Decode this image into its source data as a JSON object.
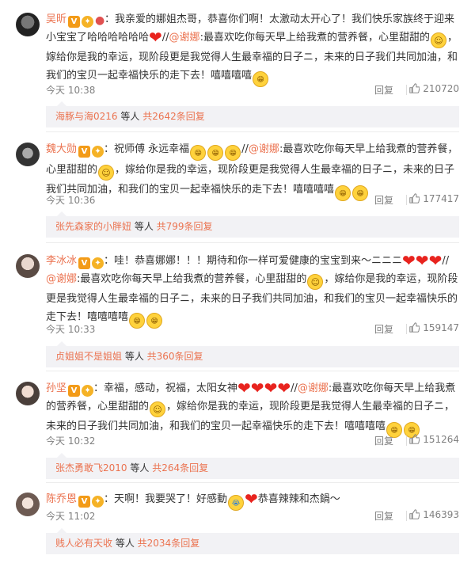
{
  "comments": [
    {
      "username": "吴昕",
      "text_1": "：我亲爱的娜姐杰哥，恭喜你们啊！太激动太开心了！我们快乐家族终于迎来小宝宝了哈哈哈哈哈哈",
      "forward": "//",
      "mention": "@谢娜",
      "text_2": ":最喜欢吃你每天早上给我煮的营养餐，心里甜甜的",
      "text_3": "，嫁给你是我的幸运，现阶段更是我觉得人生最幸福的日子ニ，未来的日子我们共同加油，和我们的宝贝一起幸福快乐的走下去！嘻嘻嘻嘻",
      "time": "今天 10:38",
      "reply_label": "回复",
      "likes": "210720",
      "sub_user": "海豚与海0216",
      "sub_mid": " 等人 ",
      "sub_total": "共2642条回复"
    },
    {
      "username": "魏大勋",
      "text_1": "：祝师傅 永远幸福",
      "forward": "//",
      "mention": "@谢娜",
      "text_2": ":最喜欢吃你每天早上给我煮的营养餐，心里甜甜的",
      "text_3": "，嫁给你是我的幸运，现阶段更是我觉得人生最幸福的日子ニ，未来的日子我们共同加油，和我们的宝贝一起幸福快乐的走下去！嘻嘻嘻嘻",
      "time": "今天 10:36",
      "reply_label": "回复",
      "likes": "177417",
      "sub_user": "张先森家的小胖妞",
      "sub_mid": " 等人 ",
      "sub_total": "共799条回复"
    },
    {
      "username": "李冰冰",
      "text_1": "：哇！恭喜娜娜！！！期待和你一样可爱健康的宝宝到来～ニニニ",
      "forward": "//",
      "mention": "@谢娜",
      "text_2": ":最喜欢吃你每天早上给我煮的营养餐，心里甜甜的",
      "text_3": "，嫁给你是我的幸运，现阶段更是我觉得人生最幸福的日子ニ，未来的日子我们共同加油，和我们的宝贝一起幸福快乐的走下去！嘻嘻嘻嘻",
      "time": "今天 10:33",
      "reply_label": "回复",
      "likes": "159147",
      "sub_user": "贞姐姐不是姐姐",
      "sub_mid": " 等人 ",
      "sub_total": "共360条回复"
    },
    {
      "username": "孙坚",
      "text_1": "：幸福，感动，祝福，太阳女神",
      "forward": "//",
      "mention": "@谢娜",
      "text_2": ":最喜欢吃你每天早上给我煮的营养餐，心里甜甜的",
      "text_3": "，嫁给你是我的幸运，现阶段更是我觉得人生最幸福的日子ニ，未来的日子我们共同加油，和我们的宝贝一起幸福快乐的走下去！嘻嘻嘻嘻",
      "time": "今天 10:32",
      "reply_label": "回复",
      "likes": "151264",
      "sub_user": "张杰勇敢飞2010",
      "sub_mid": " 等人 ",
      "sub_total": "共264条回复"
    },
    {
      "username": "陈乔恩",
      "text_1": "：天啊！我要哭了！好感動",
      "text_2": "恭喜辣辣和杰鍋～",
      "time": "今天 11:02",
      "reply_label": "回复",
      "likes": "146393",
      "sub_user": "贱人必有天收",
      "sub_mid": " 等人 ",
      "sub_total": "共2034条回复"
    }
  ],
  "emoticons": {
    "grin": "😁",
    "smile": "☺",
    "cry": "😭",
    "heart": "❤"
  },
  "badges": {
    "verified": "V",
    "vip": "✦",
    "rank": "LV"
  }
}
